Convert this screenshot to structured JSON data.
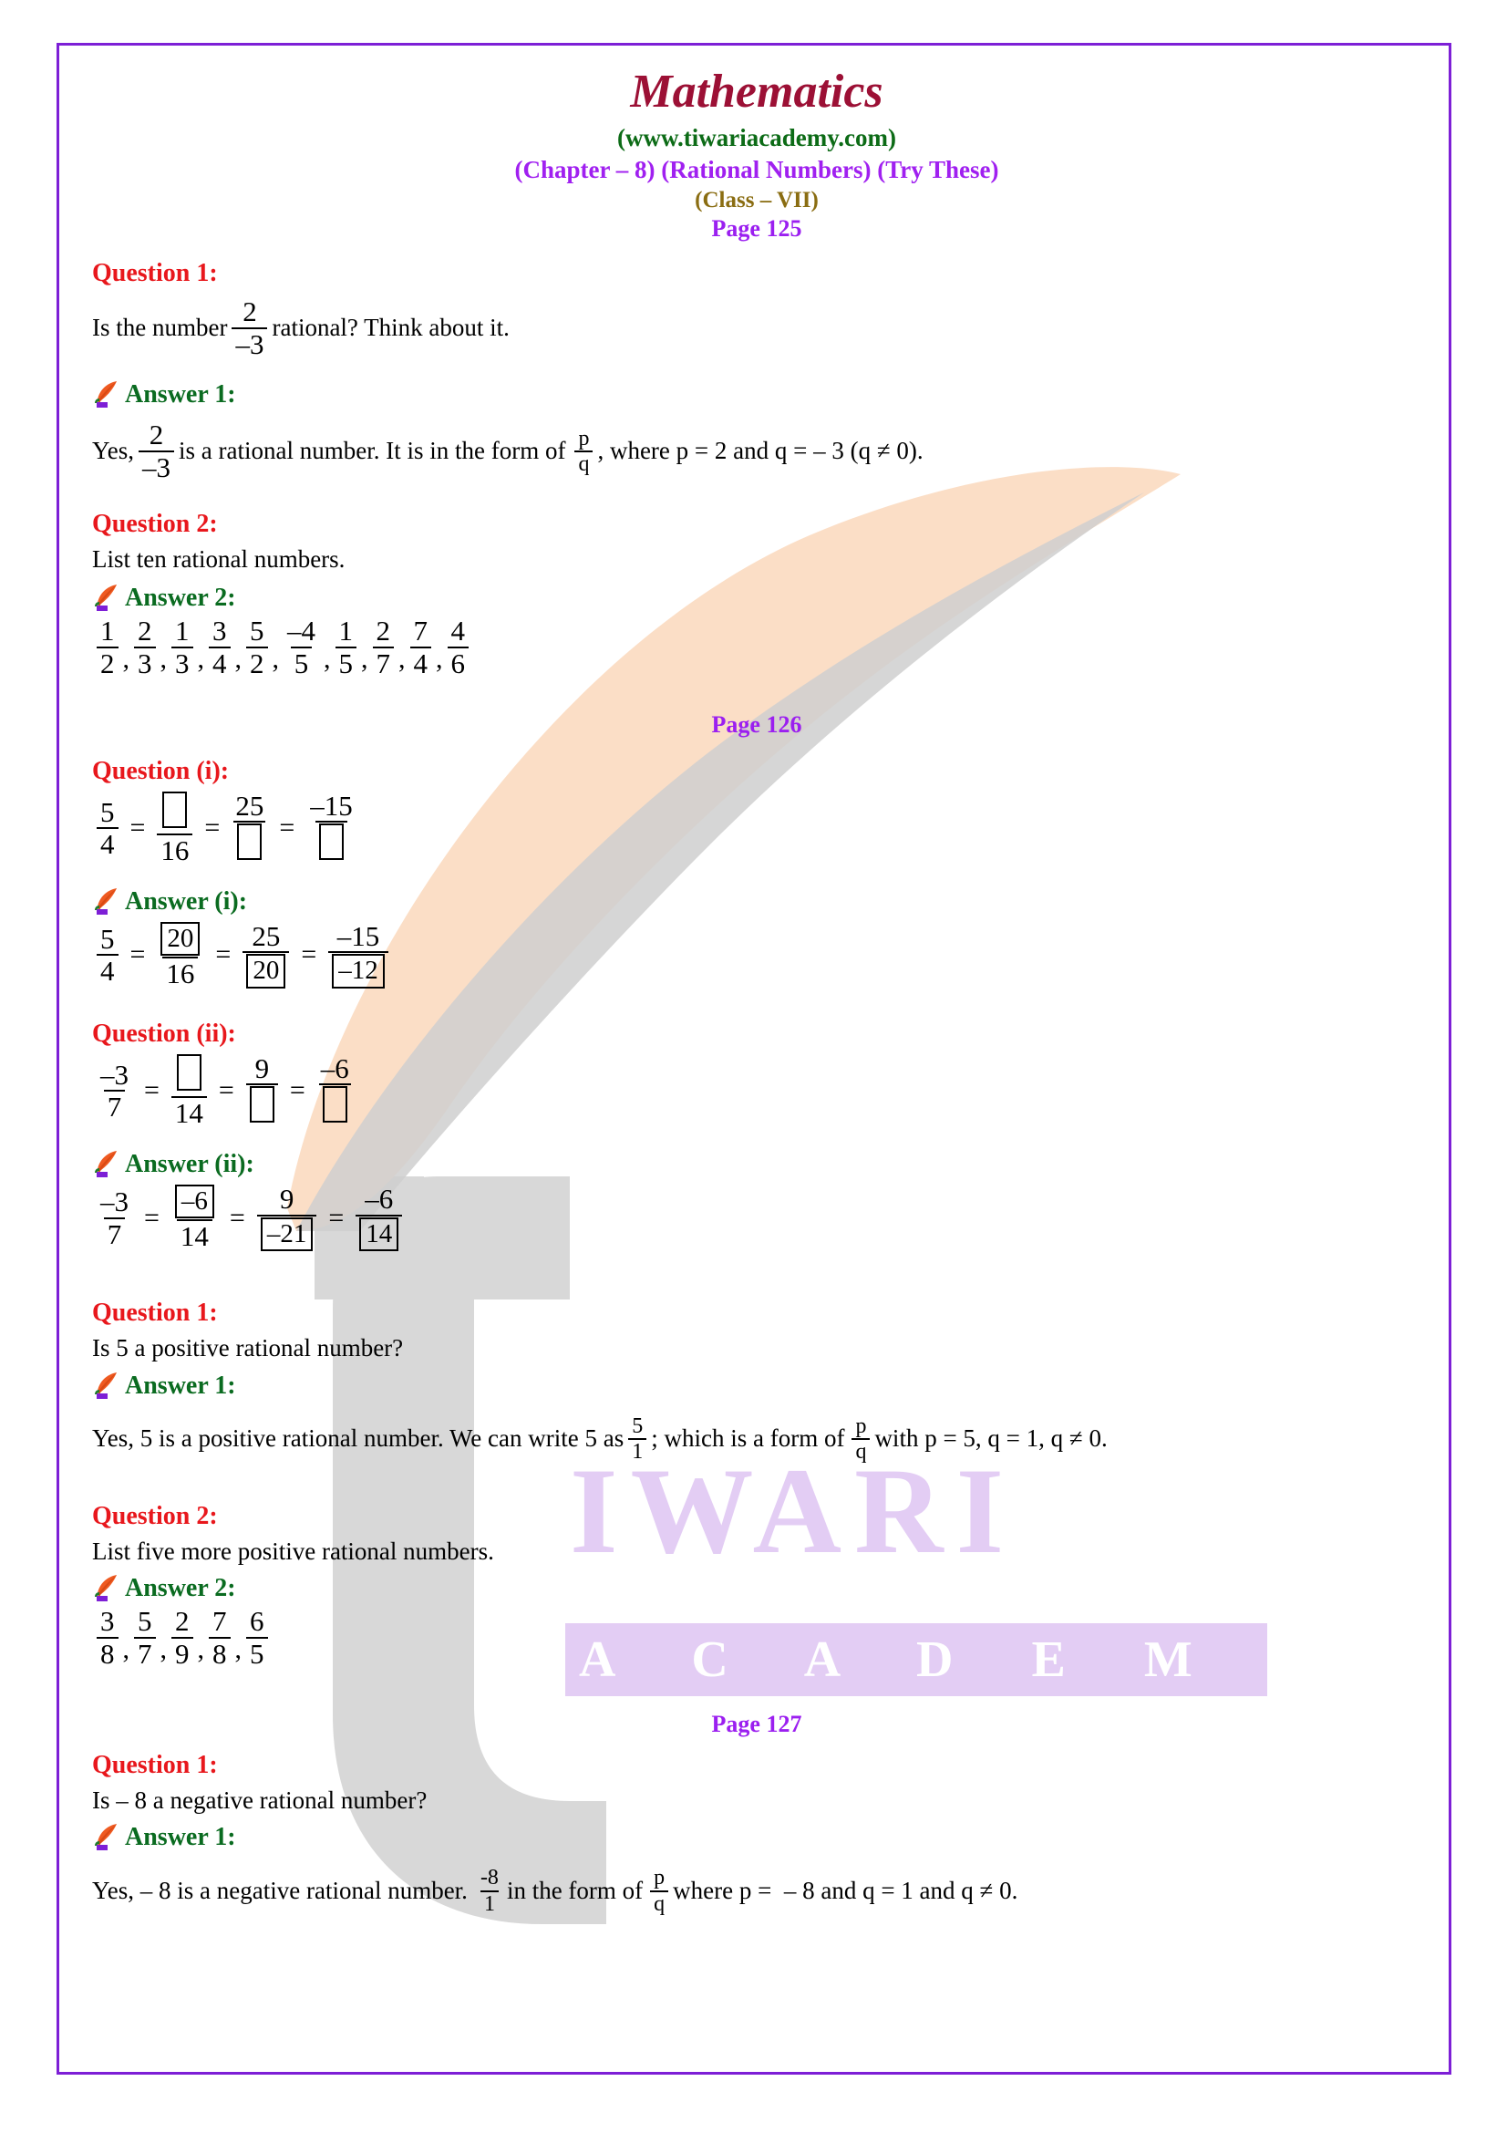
{
  "header": {
    "title": "Mathematics",
    "website": "(www.tiwariacademy.com)",
    "chapter": "(Chapter – 8) (Rational Numbers) (Try These)",
    "class": "(Class – VII)",
    "page125": "Page 125",
    "page126": "Page 126",
    "page127": "Page 127"
  },
  "watermark": {
    "brand": "IWARI",
    "subbrand": "A C A D E M Y"
  },
  "sections": {
    "q1_125": {
      "heading": "Question 1:",
      "text_before": "Is the number",
      "frac_num": "2",
      "frac_den": "–3",
      "text_after": "rational? Think about it."
    },
    "a1_125": {
      "heading": "Answer 1:",
      "t1": "Yes,",
      "f1_num": "2",
      "f1_den": "–3",
      "t2": "is a rational number. It is in the form of",
      "f2_num": "p",
      "f2_den": "q",
      "t3": ", where p = 2 and q = – 3 (q ≠ 0)."
    },
    "q2_125": {
      "heading": "Question 2:",
      "text": "List ten rational numbers."
    },
    "a2_125": {
      "heading": "Answer 2:",
      "fractions": [
        {
          "n": "1",
          "d": "2"
        },
        {
          "n": "2",
          "d": "3"
        },
        {
          "n": "1",
          "d": "3"
        },
        {
          "n": "3",
          "d": "4"
        },
        {
          "n": "5",
          "d": "2"
        },
        {
          "n": "–4",
          "d": "5"
        },
        {
          "n": "1",
          "d": "5"
        },
        {
          "n": "2",
          "d": "7"
        },
        {
          "n": "7",
          "d": "4"
        },
        {
          "n": "4",
          "d": "6"
        }
      ],
      "separator": ","
    },
    "qi_126": {
      "heading": "Question (i):",
      "terms": [
        {
          "n": "5",
          "d": "4",
          "n_box": false,
          "d_box": false
        },
        {
          "n": "",
          "d": "16",
          "n_box": "blank",
          "d_box": false
        },
        {
          "n": "25",
          "d": "",
          "n_box": false,
          "d_box": "blank"
        },
        {
          "n": "–15",
          "d": "",
          "n_box": false,
          "d_box": "blank"
        }
      ]
    },
    "ai_126": {
      "heading": "Answer (i):",
      "terms": [
        {
          "n": "5",
          "d": "4",
          "n_box": false,
          "d_box": false
        },
        {
          "n": "20",
          "d": "16",
          "n_box": true,
          "d_box": false
        },
        {
          "n": "25",
          "d": "20",
          "n_box": false,
          "d_box": true
        },
        {
          "n": "–15",
          "d": "–12",
          "n_box": false,
          "d_box": true
        }
      ]
    },
    "qii_126": {
      "heading": "Question (ii):",
      "terms": [
        {
          "n": "–3",
          "d": "7",
          "n_box": false,
          "d_box": false
        },
        {
          "n": "",
          "d": "14",
          "n_box": "blank",
          "d_box": false
        },
        {
          "n": "9",
          "d": "",
          "n_box": false,
          "d_box": "blank"
        },
        {
          "n": "–6",
          "d": "",
          "n_box": false,
          "d_box": "blank"
        }
      ]
    },
    "aii_126": {
      "heading": "Answer (ii):",
      "terms": [
        {
          "n": "–3",
          "d": "7",
          "n_box": false,
          "d_box": false
        },
        {
          "n": "–6",
          "d": "14",
          "n_box": true,
          "d_box": false
        },
        {
          "n": "9",
          "d": "–21",
          "n_box": false,
          "d_box": true
        },
        {
          "n": "–6",
          "d": "14",
          "n_box": false,
          "d_box": true
        }
      ]
    },
    "q1_126b": {
      "heading": "Question 1:",
      "text": "Is 5 a positive rational number?"
    },
    "a1_126b": {
      "heading": "Answer 1:",
      "t1": "Yes, 5 is a positive rational number. We can write 5 as",
      "f1_num": "5",
      "f1_den": "1",
      "t2": "; which is a form of",
      "f2_num": "p",
      "f2_den": "q",
      "t3": "with p = 5, q = 1, q ≠ 0."
    },
    "q2_126b": {
      "heading": "Question 2:",
      "text": "List five more positive rational numbers."
    },
    "a2_126b": {
      "heading": "Answer 2:",
      "fractions": [
        {
          "n": "3",
          "d": "8"
        },
        {
          "n": "5",
          "d": "7"
        },
        {
          "n": "2",
          "d": "9"
        },
        {
          "n": "7",
          "d": "8"
        },
        {
          "n": "6",
          "d": "5"
        }
      ],
      "separator": ","
    },
    "q1_127": {
      "heading": "Question 1:",
      "text": "Is – 8 a negative rational number?"
    },
    "a1_127": {
      "heading": "Answer 1:",
      "t1": "Yes, – 8 is a negative rational number.",
      "f1_num": "-8",
      "f1_den": "1",
      "t2": "in the form of",
      "f2_num": "p",
      "f2_den": "q",
      "t3": "where p =  – 8 and q = 1 and q ≠ 0."
    }
  },
  "colors": {
    "border": "#7d1fd6",
    "title": "#9c1035",
    "site": "#0c6b16",
    "chapter": "#a020f0",
    "class": "#8a6d12",
    "page": "#9b1ff0",
    "question": "#e8171c",
    "answer": "#0a6b20",
    "watermark_leaf": "#fbdec6",
    "watermark_t": "#d6d6d6",
    "watermark_text": "#e3cdf4"
  }
}
